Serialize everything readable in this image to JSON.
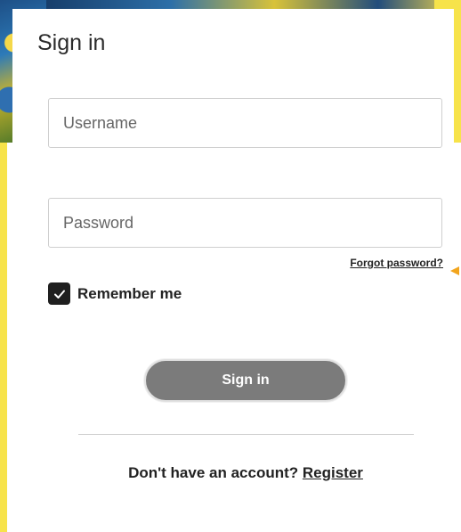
{
  "signin": {
    "title": "Sign in",
    "username_placeholder": "Username",
    "password_placeholder": "Password",
    "forgot_password_label": "Forgot password?",
    "remember_me_label": "Remember me",
    "remember_me_checked": true,
    "submit_label": "Sign in",
    "no_account_text": "Don't have an account?",
    "register_label": "Register"
  },
  "colors": {
    "button_bg": "#7b7b7b",
    "checkbox_bg": "#1f1f1f",
    "accent_yellow": "#f7e34a",
    "marker_orange": "#f2a51d"
  }
}
